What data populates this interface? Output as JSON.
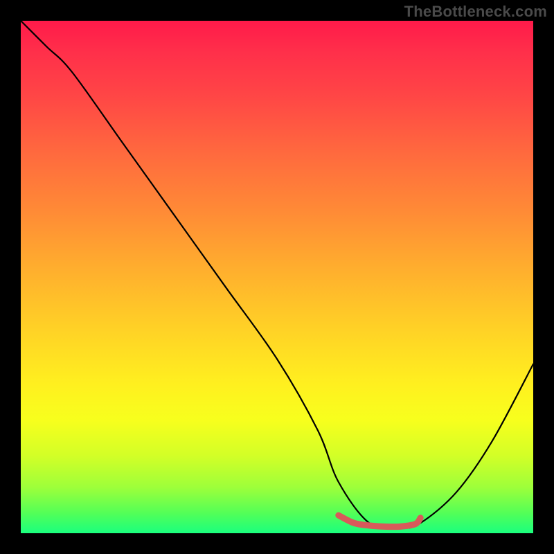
{
  "watermark": "TheBottleneck.com",
  "chart_data": {
    "type": "line",
    "title": "",
    "xlabel": "",
    "ylabel": "",
    "xlim": [
      0,
      100
    ],
    "ylim": [
      0,
      100
    ],
    "series": [
      {
        "name": "bottleneck-curve",
        "x": [
          0,
          5,
          10,
          20,
          30,
          40,
          50,
          58,
          62,
          68,
          74,
          78,
          85,
          92,
          100
        ],
        "values": [
          100,
          95,
          90,
          76,
          62,
          48,
          34,
          20,
          10,
          2,
          1,
          2,
          8,
          18,
          33
        ]
      }
    ],
    "highlight_segment": {
      "name": "minimum-band",
      "color": "#d85a5a",
      "x": [
        62,
        65,
        68,
        71,
        74,
        77,
        78
      ],
      "values": [
        3.5,
        2.0,
        1.5,
        1.3,
        1.3,
        1.8,
        3.0
      ]
    },
    "background_gradient": {
      "top": "#ff1a4a",
      "bottom": "#1aff7e"
    }
  }
}
